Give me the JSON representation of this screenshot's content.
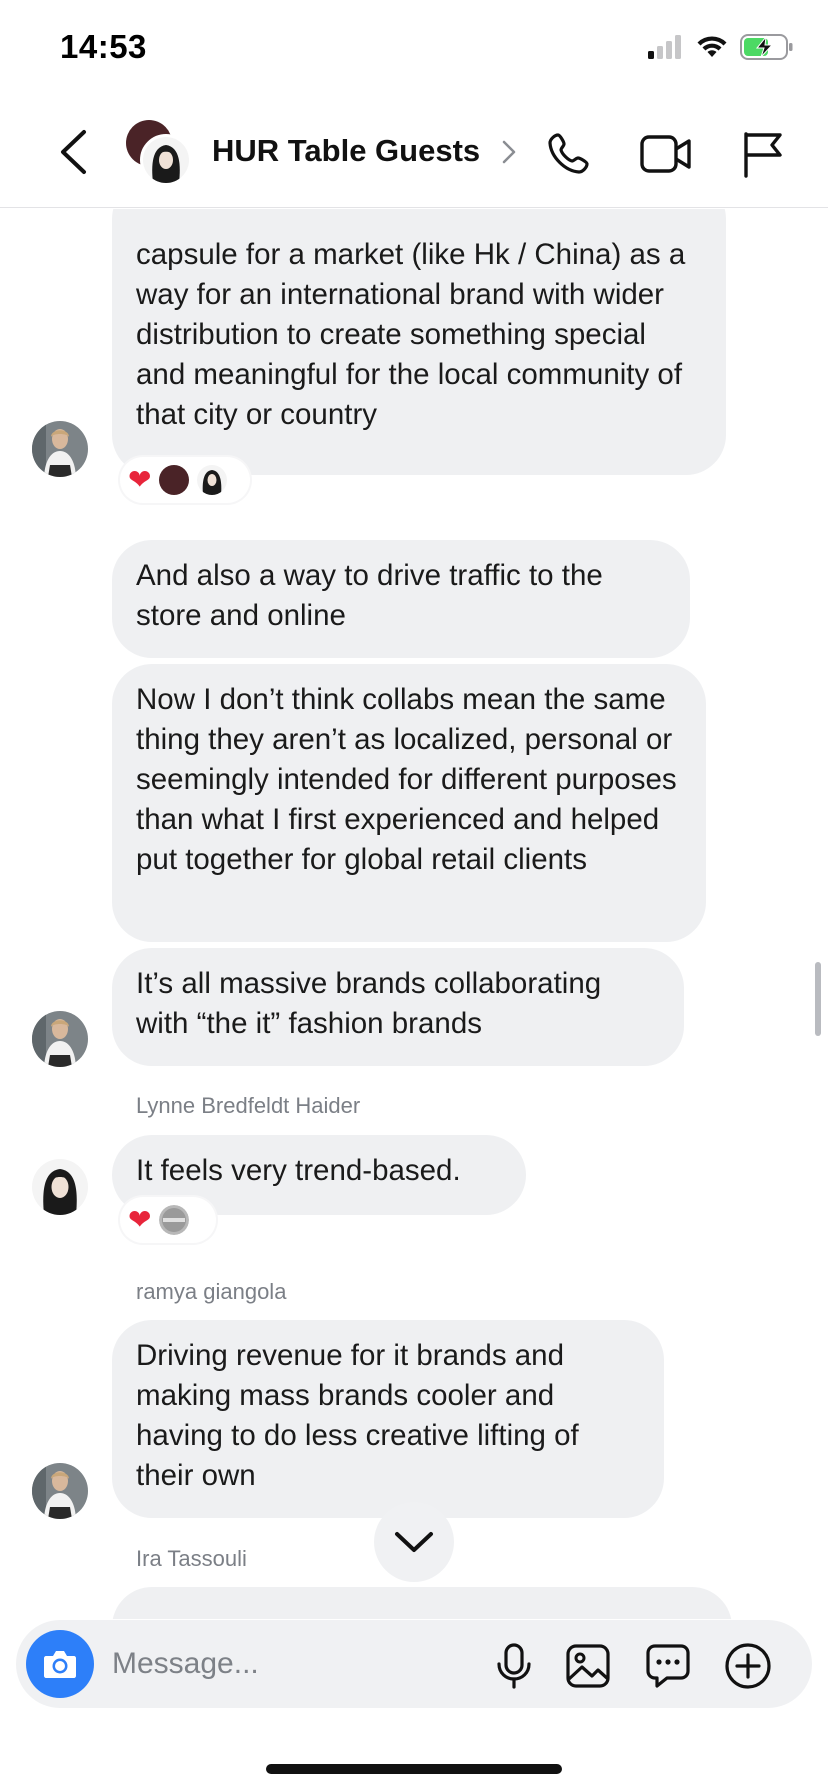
{
  "status_bar": {
    "time": "14:53",
    "icons": [
      "cellular-signal-icon",
      "wifi-icon",
      "battery-charging-icon"
    ],
    "battery_color": "#4cd964"
  },
  "header": {
    "back_icon": "chevron-left-icon",
    "title": "HUR Table Guests",
    "title_chevron_icon": "chevron-right-icon",
    "actions": [
      "phone-icon",
      "video-camera-icon",
      "flag-icon"
    ]
  },
  "messages": [
    {
      "id": "m1",
      "text": "capsule for a market (like Hk / China) as a way for an international brand with wider distribution to create something special and meaningful for the local community of that city or country",
      "reactions": [
        "heart",
        "avatar-dark",
        "avatar-girl"
      ]
    },
    {
      "id": "m2",
      "text": "And also a way to drive traffic to the store and online"
    },
    {
      "id": "m3",
      "text": "Now I don’t think collabs mean the same thing they aren’t as localized, personal or seemingly intended for different purposes than what I first experienced and helped put together for global retail clients"
    },
    {
      "id": "m4",
      "text": "It’s all massive brands collaborating with “the it” fashion brands"
    },
    {
      "id": "m5",
      "sender": "Lynne Bredfeldt Haider",
      "text": "It feels very trend-based.",
      "reactions": [
        "heart",
        "avatar-gray"
      ]
    },
    {
      "id": "m6",
      "sender": "ramya giangola",
      "text": "Driving revenue for it brands and making mass brands cooler and having to do less creative lifting of their own"
    },
    {
      "id": "m7",
      "sender": "Ira Tassouli"
    }
  ],
  "composer": {
    "placeholder": "Message...",
    "camera_icon": "camera-icon",
    "actions": [
      "microphone-icon",
      "image-icon",
      "chat-bubble-icon",
      "plus-circle-icon"
    ],
    "accent": "#2d7ff9"
  },
  "scroll_down_icon": "chevron-down-icon",
  "colors": {
    "bubble_bg": "#eff0f2",
    "sender_name": "#7b7f86",
    "heart": "#e8253b"
  }
}
